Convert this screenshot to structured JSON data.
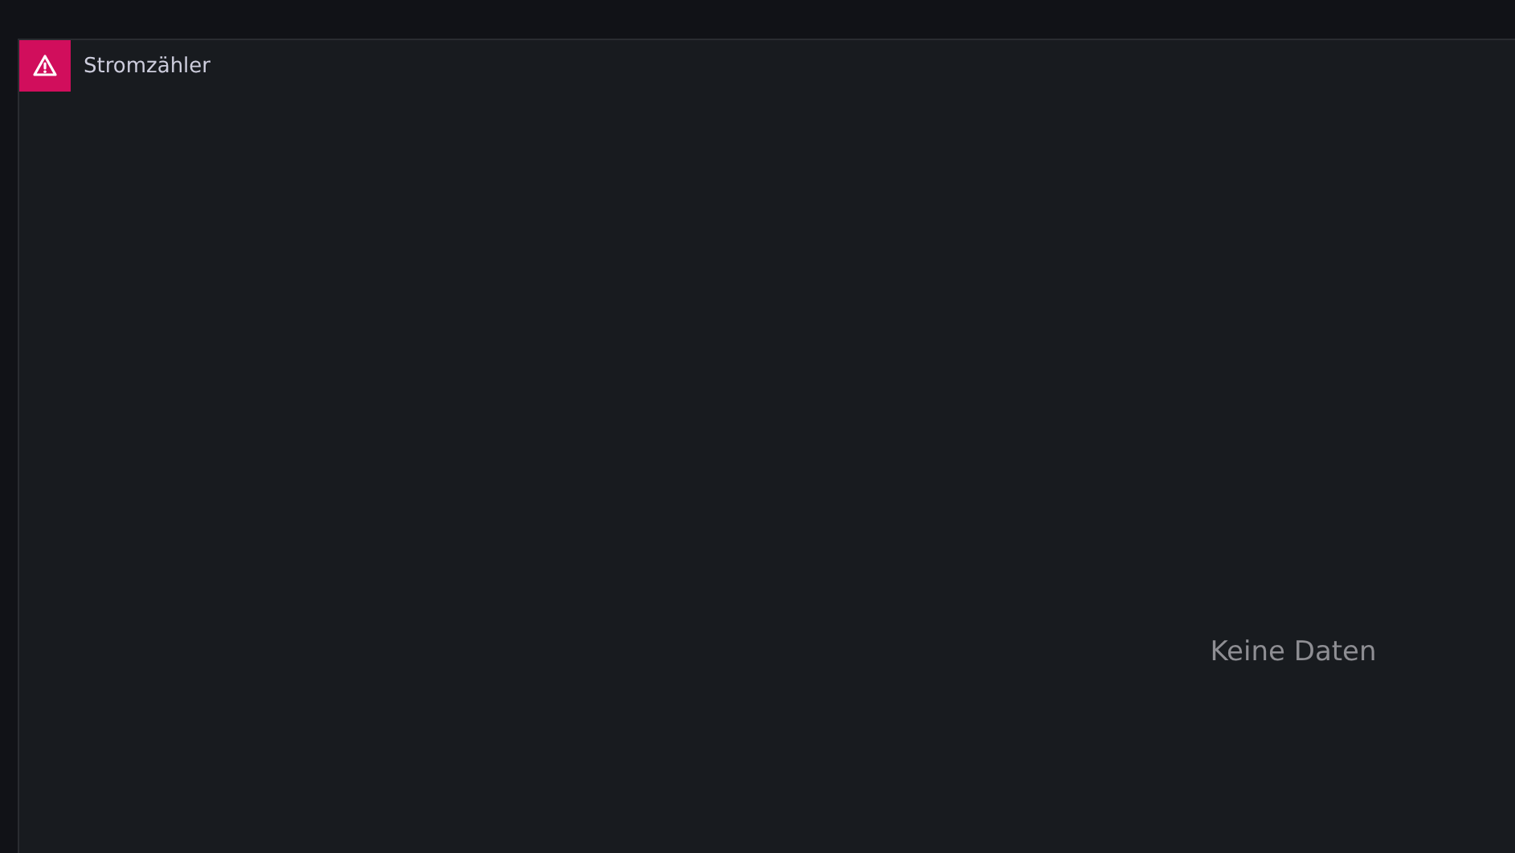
{
  "panel": {
    "title": "Stromzähler",
    "error": true,
    "message": "Keine Daten"
  }
}
